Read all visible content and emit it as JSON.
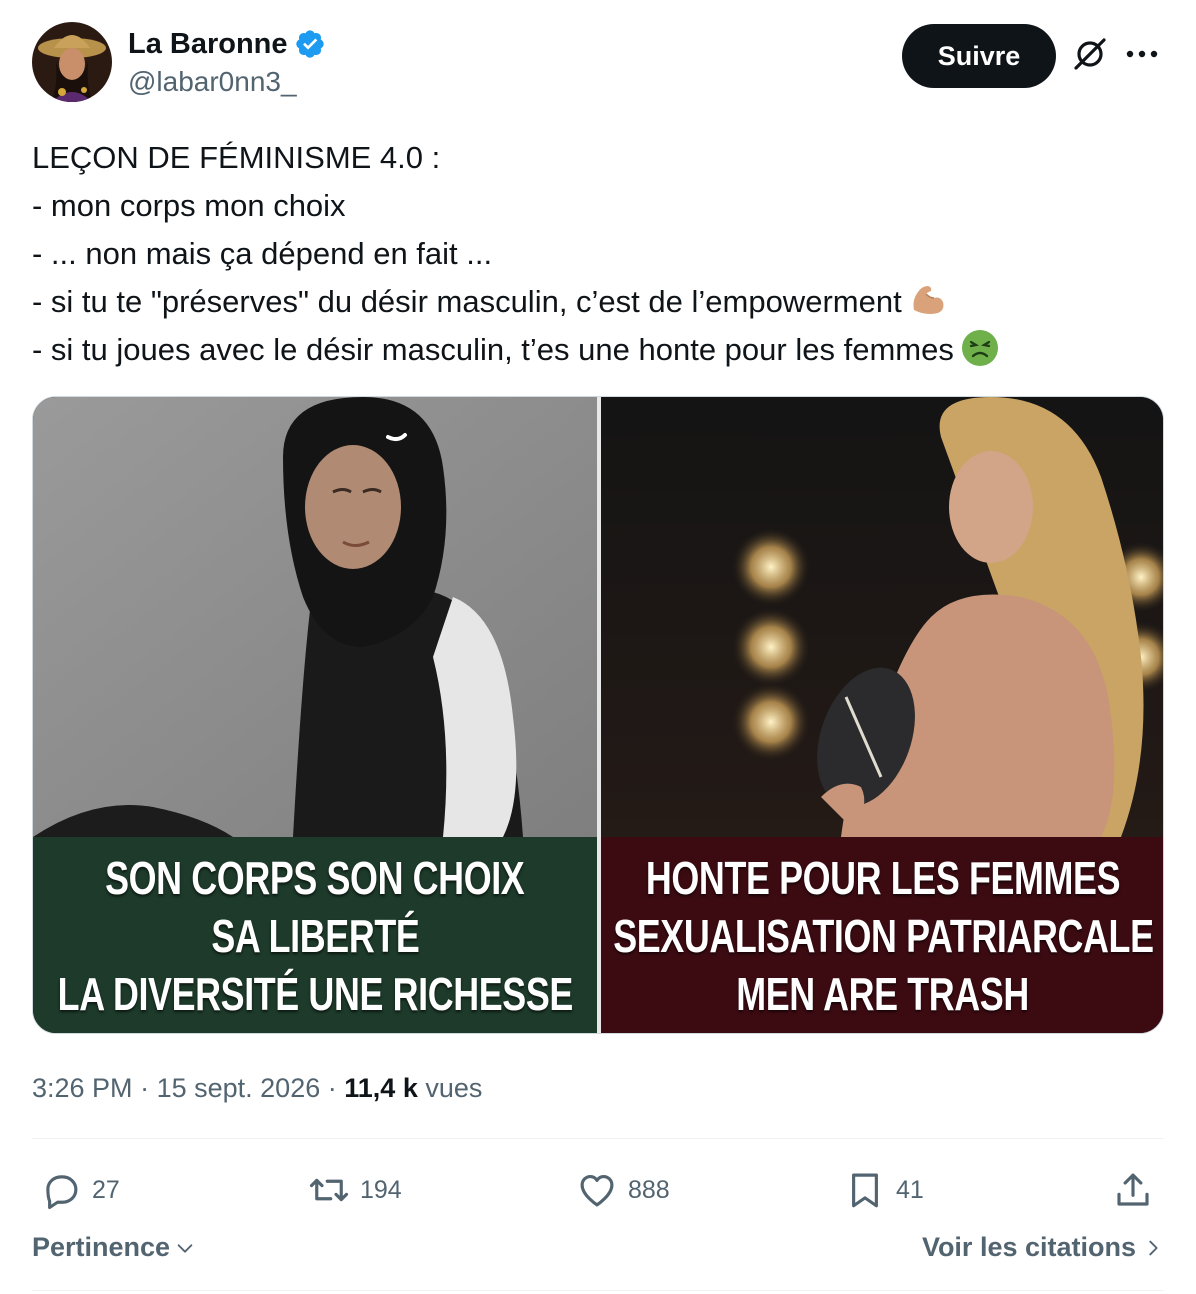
{
  "author": {
    "display_name": "La Baronne",
    "handle": "@labar0nn3_",
    "verified": true
  },
  "header": {
    "follow_label": "Suivre",
    "icons": [
      "grok-icon",
      "more-icon"
    ]
  },
  "tweet": {
    "lines": [
      "LEÇON DE FÉMINISME 4.0 :",
      "- mon corps mon choix",
      "- ... non mais ça dépend en fait ...",
      "- si tu te \"préserves\" du désir masculin, c’est de l’empowerment",
      "- si tu joues avec le désir masculin, t’es une honte pour les femmes"
    ],
    "emojis": [
      "flexed-biceps",
      "nauseated-face"
    ]
  },
  "media": {
    "left_caption": [
      "SON CORPS SON CHOIX",
      "SA LIBERTÉ",
      "LA DIVERSITÉ UNE RICHESSE"
    ],
    "right_caption": [
      "HONTE POUR LES FEMMES",
      "SEXUALISATION PATRIARCALE",
      "MEN ARE TRASH"
    ]
  },
  "meta": {
    "time": "3:26 PM",
    "dot": "·",
    "date": "15 sept. 2026",
    "views_count": "11,4 k",
    "views_label": "vues"
  },
  "actions": {
    "replies": "27",
    "reposts": "194",
    "likes": "888",
    "bookmarks": "41"
  },
  "footer": {
    "sort_label": "Pertinence",
    "quotes_label": "Voir les citations"
  },
  "colors": {
    "accent_verified": "#1d9bf0",
    "text_primary": "#0f1419",
    "text_secondary": "#536471",
    "caption_green": "#1d3a2a",
    "caption_red": "#3c0b12"
  }
}
